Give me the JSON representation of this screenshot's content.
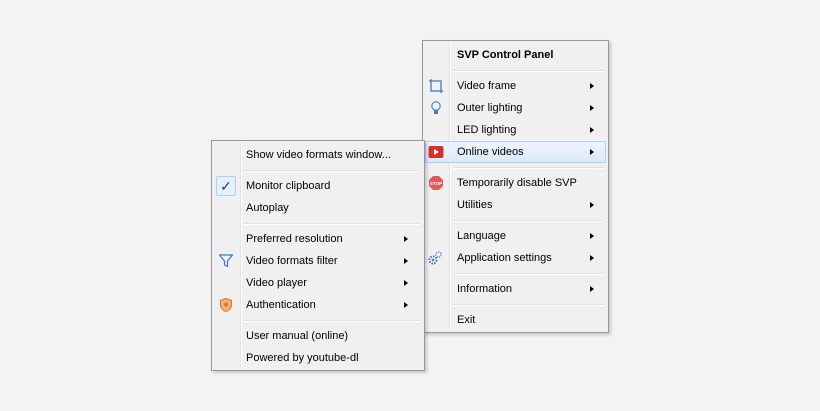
{
  "svp_menu": {
    "title": "SVP Control Panel",
    "items": [
      {
        "label": "Video frame",
        "icon": "crop-frame-icon"
      },
      {
        "label": "Outer lighting",
        "icon": "light-bulb-icon"
      },
      {
        "label": "LED lighting"
      },
      {
        "label": "Online videos",
        "icon": "youtube-play-icon",
        "highlighted": true
      },
      {
        "label": "Temporarily disable SVP",
        "icon": "stop-sign-icon"
      },
      {
        "label": "Utilities"
      },
      {
        "label": "Language"
      },
      {
        "label": "Application settings",
        "icon": "gears-icon"
      },
      {
        "label": "Information"
      },
      {
        "label": "Exit"
      }
    ]
  },
  "online_videos_submenu": {
    "items": [
      {
        "label": "Show video formats window..."
      },
      {
        "label": "Monitor clipboard",
        "checked": true
      },
      {
        "label": "Autoplay"
      },
      {
        "label": "Preferred resolution"
      },
      {
        "label": "Video formats filter",
        "icon": "filter-funnel-icon"
      },
      {
        "label": "Video player"
      },
      {
        "label": "Authentication",
        "icon": "shield-icon"
      },
      {
        "label": "User manual (online)"
      },
      {
        "label": "Powered by youtube-dl"
      }
    ],
    "check_mark": "✓"
  },
  "colors": {
    "menu_background": "#f0f0f0",
    "highlight_border": "#aecff7",
    "youtube_red": "#d9302a",
    "stop_red": "#e05a5a",
    "filter_blue": "#3a78c2",
    "shield_orange": "#e8742a"
  }
}
